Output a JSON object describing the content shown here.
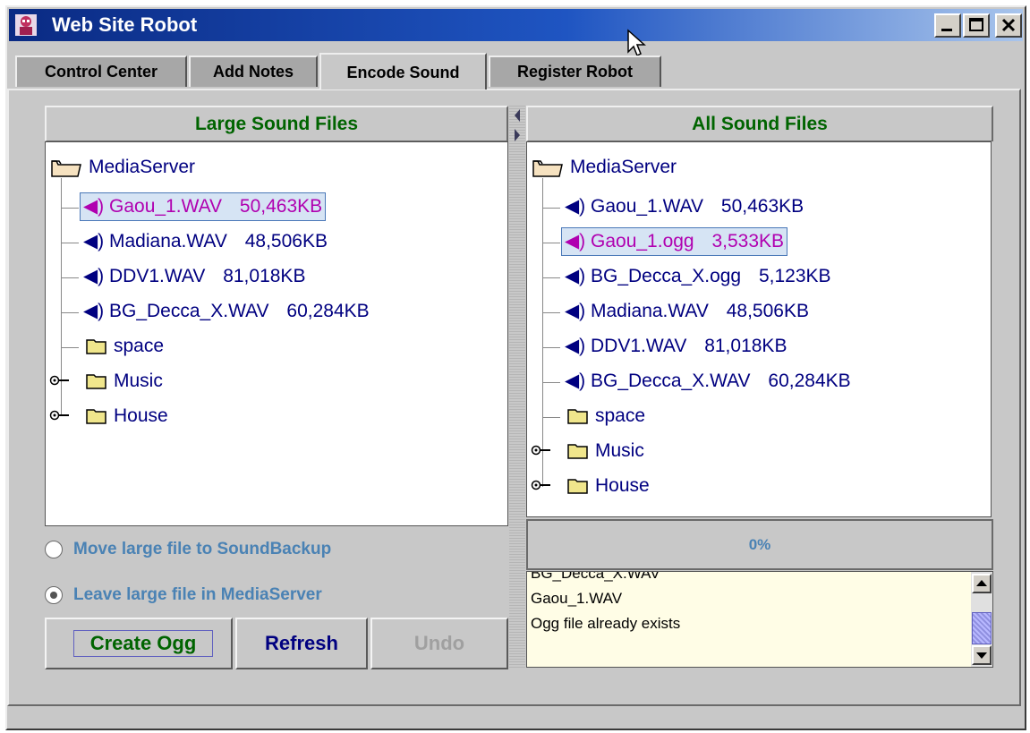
{
  "window": {
    "title": "Web Site Robot"
  },
  "tabs": [
    {
      "label": "Control Center",
      "active": false
    },
    {
      "label": "Add Notes",
      "active": false
    },
    {
      "label": "Encode Sound",
      "active": true
    },
    {
      "label": "Register Robot",
      "active": false
    }
  ],
  "left_panel": {
    "header": "Large Sound Files",
    "root": "MediaServer",
    "files": [
      {
        "name": "Gaou_1.WAV",
        "size": "50,463KB",
        "selected": true
      },
      {
        "name": "Madiana.WAV",
        "size": "48,506KB",
        "selected": false
      },
      {
        "name": "DDV1.WAV",
        "size": "81,018KB",
        "selected": false
      },
      {
        "name": "BG_Decca_X.WAV",
        "size": "60,284KB",
        "selected": false
      }
    ],
    "folders": [
      "space",
      "Music",
      "House"
    ]
  },
  "right_panel": {
    "header": "All Sound Files",
    "root": "MediaServer",
    "files": [
      {
        "name": "Gaou_1.WAV",
        "size": "50,463KB",
        "selected": false
      },
      {
        "name": "Gaou_1.ogg",
        "size": "3,533KB",
        "selected": true
      },
      {
        "name": "BG_Decca_X.ogg",
        "size": "5,123KB",
        "selected": false
      },
      {
        "name": "Madiana.WAV",
        "size": "48,506KB",
        "selected": false
      },
      {
        "name": "DDV1.WAV",
        "size": "81,018KB",
        "selected": false
      },
      {
        "name": "BG_Decca_X.WAV",
        "size": "60,284KB",
        "selected": false
      }
    ],
    "folders": [
      "space",
      "Music",
      "House"
    ]
  },
  "options": {
    "move_label": "Move large file to SoundBackup",
    "leave_label": "Leave large file in MediaServer",
    "selected": "leave"
  },
  "buttons": {
    "create_ogg": "Create Ogg",
    "refresh": "Refresh",
    "undo": "Undo"
  },
  "progress": {
    "label": "0%",
    "value": 0
  },
  "log": {
    "lines": [
      "BG_Decca_X.WAV",
      "Gaou_1.WAV",
      "Ogg file already exists"
    ]
  },
  "colors": {
    "header_text": "#006400",
    "tree_text": "#000080",
    "selected_text": "#b000b0",
    "option_text": "#4a82b4",
    "log_background": "#fffde6"
  }
}
